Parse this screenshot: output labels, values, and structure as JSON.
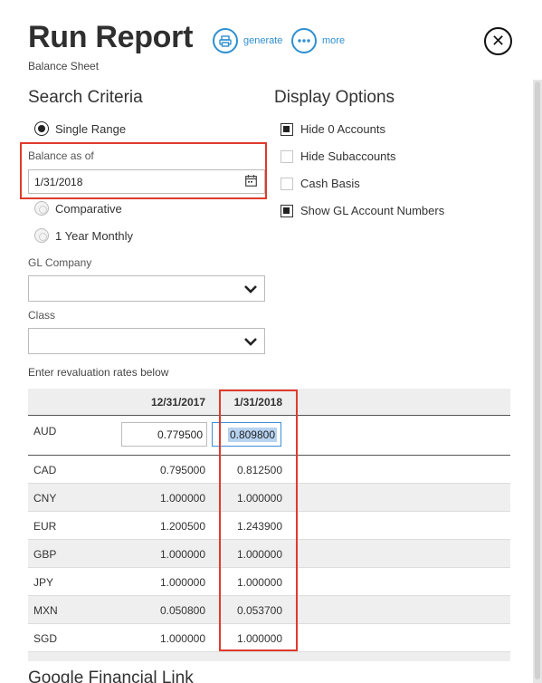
{
  "header": {
    "title": "Run Report",
    "subtitle": "Balance Sheet",
    "generate_label": "generate",
    "more_label": "more",
    "close_label": "✕"
  },
  "search_criteria": {
    "heading": "Search Criteria",
    "single_range_label": "Single Range",
    "balance_as_of_label": "Balance as of",
    "balance_as_of_value": "1/31/2018",
    "comparative_label": "Comparative",
    "year_monthly_label": "1 Year Monthly",
    "gl_company_label": "GL Company",
    "gl_company_value": "",
    "class_label": "Class",
    "class_value": "",
    "selected_range": "Single Range"
  },
  "display_options": {
    "heading": "Display Options",
    "items": [
      {
        "label": "Hide 0 Accounts",
        "checked": true
      },
      {
        "label": "Hide Subaccounts",
        "checked": false
      },
      {
        "label": "Cash Basis",
        "checked": false
      },
      {
        "label": "Show GL Account Numbers",
        "checked": true
      }
    ]
  },
  "revaluation": {
    "note": "Enter revaluation rates below",
    "columns": [
      "12/31/2017",
      "1/31/2018"
    ],
    "rows": [
      {
        "currency": "AUD",
        "v1": "0.779500",
        "v2": "0.809800"
      },
      {
        "currency": "CAD",
        "v1": "0.795000",
        "v2": "0.812500"
      },
      {
        "currency": "CNY",
        "v1": "1.000000",
        "v2": "1.000000"
      },
      {
        "currency": "EUR",
        "v1": "1.200500",
        "v2": "1.243900"
      },
      {
        "currency": "GBP",
        "v1": "1.000000",
        "v2": "1.000000"
      },
      {
        "currency": "JPY",
        "v1": "1.000000",
        "v2": "1.000000"
      },
      {
        "currency": "MXN",
        "v1": "0.050800",
        "v2": "0.053700"
      },
      {
        "currency": "SGD",
        "v1": "1.000000",
        "v2": "1.000000"
      }
    ]
  },
  "next_section": {
    "heading": "Google Financial Link"
  },
  "colors": {
    "accent": "#2f8fd0",
    "highlight": "#e03a2c",
    "row_alt": "#efefef"
  }
}
